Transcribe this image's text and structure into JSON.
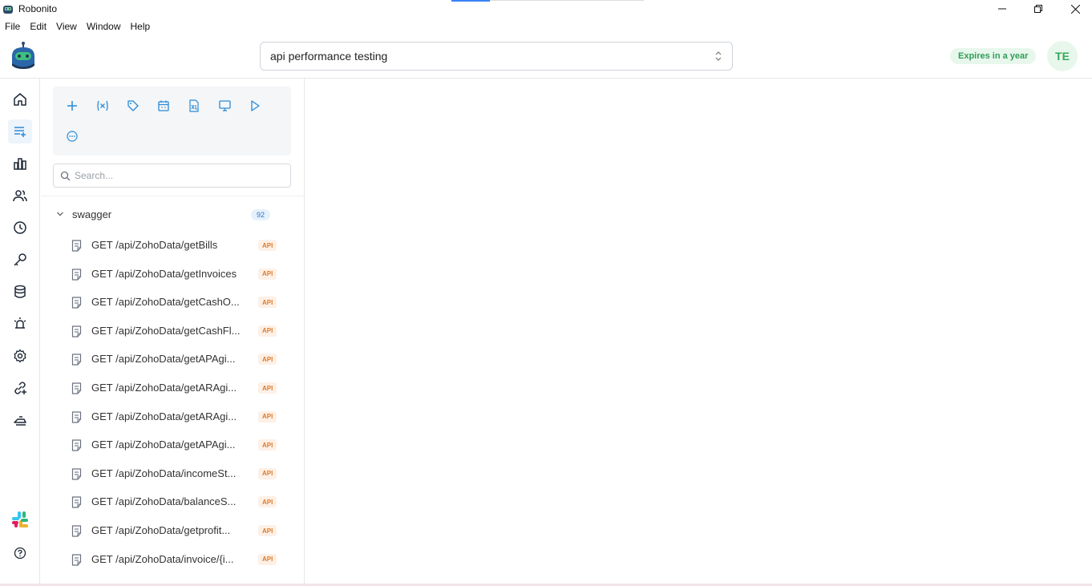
{
  "window": {
    "title": "Robonito",
    "controls": [
      "minimize-icon",
      "restore-icon",
      "close-icon"
    ]
  },
  "menu": [
    "File",
    "Edit",
    "View",
    "Window",
    "Help"
  ],
  "header": {
    "project_select_value": "api performance testing",
    "expires_badge": "Expires in a year",
    "avatar_initials": "TE"
  },
  "colors": {
    "accent": "#2a8bd6",
    "api_badge": "#e07b2a",
    "expires_green": "#2f9e57"
  },
  "sidebar": {
    "icons": [
      "home-icon",
      "test-list-icon",
      "reports-chart-icon",
      "users-icon",
      "history-clock-icon",
      "key-icon",
      "database-icon",
      "alarm-icon",
      "settings-gear-icon",
      "integration-link-icon",
      "cloud-run-icon"
    ],
    "active": "test-list-icon",
    "bottom_icons": [
      "slack-icon",
      "help-icon"
    ]
  },
  "toolbar": {
    "icons": [
      "add-icon",
      "variables-icon",
      "tag-icon",
      "calendar-icon",
      "excel-import-icon",
      "monitor-icon",
      "run-play-icon",
      "more-icon"
    ]
  },
  "search": {
    "placeholder": "Search..."
  },
  "tree": {
    "folder": "swagger",
    "count": "92",
    "badge": "API",
    "items": [
      "GET /api/ZohoData/getBills",
      "GET /api/ZohoData/getInvoices",
      "GET /api/ZohoData/getCashO...",
      "GET /api/ZohoData/getCashFl...",
      "GET /api/ZohoData/getAPAgi...",
      "GET /api/ZohoData/getARAgi...",
      "GET /api/ZohoData/getARAgi...",
      "GET /api/ZohoData/getAPAgi...",
      "GET /api/ZohoData/incomeSt...",
      "GET /api/ZohoData/balanceS...",
      "GET /api/ZohoData/getprofit...",
      "GET /api/ZohoData/invoice/{i..."
    ]
  }
}
